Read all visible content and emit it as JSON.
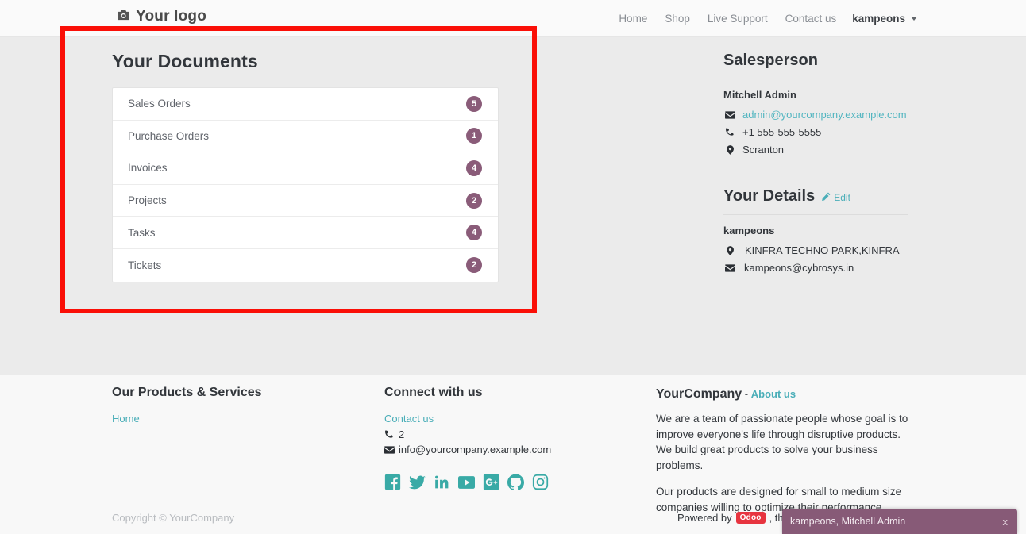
{
  "navbar": {
    "brand": "Your logo",
    "brand_icon": "camera-icon",
    "links": [
      "Home",
      "Shop",
      "Live Support",
      "Contact us"
    ],
    "user": "kampeons"
  },
  "documents": {
    "title": "Your Documents",
    "rows": [
      {
        "label": "Sales Orders",
        "count": "5"
      },
      {
        "label": "Purchase Orders",
        "count": "1"
      },
      {
        "label": "Invoices",
        "count": "4"
      },
      {
        "label": "Projects",
        "count": "2"
      },
      {
        "label": "Tasks",
        "count": "4"
      },
      {
        "label": "Tickets",
        "count": "2"
      }
    ]
  },
  "salesperson": {
    "title": "Salesperson",
    "name": "Mitchell Admin",
    "email": "admin@yourcompany.example.com",
    "phone": "+1 555-555-5555",
    "city": "Scranton"
  },
  "details": {
    "title": "Your Details",
    "edit_label": "Edit",
    "name": "kampeons",
    "address": "KINFRA TECHNO PARK,KINFRA",
    "email": "kampeons@cybrosys.in"
  },
  "footer": {
    "products": {
      "title": "Our Products & Services",
      "links": [
        "Home"
      ]
    },
    "connect": {
      "title": "Connect with us",
      "contact_label": "Contact us",
      "phone": "2",
      "email": "info@yourcompany.example.com",
      "socials": [
        "facebook-icon",
        "twitter-icon",
        "linkedin-icon",
        "youtube-icon",
        "google-plus-icon",
        "github-icon",
        "instagram-icon"
      ]
    },
    "company": {
      "name": "YourCompany",
      "about_sep": "-",
      "about_label": "About us",
      "paragraph1": "We are a team of passionate people whose goal is to improve everyone's life through disruptive products. We build great products to solve your business problems.",
      "paragraph2": "Our products are designed for small to medium size companies willing to optimize their performance."
    },
    "copyright": "Copyright © YourCompany",
    "powered_prefix": "Powered by",
    "powered_brand": "Odoo",
    "powered_suffix": ", the #"
  },
  "chat": {
    "title": "kampeons, Mitchell Admin",
    "close_label": "x"
  },
  "colors": {
    "badge": "#8a5c79",
    "accent_teal": "#4aaeb8",
    "social": "#39aaa6",
    "annotation": "#fa0f07",
    "chat_header": "#875a77",
    "odoo_red": "#e7343f"
  }
}
